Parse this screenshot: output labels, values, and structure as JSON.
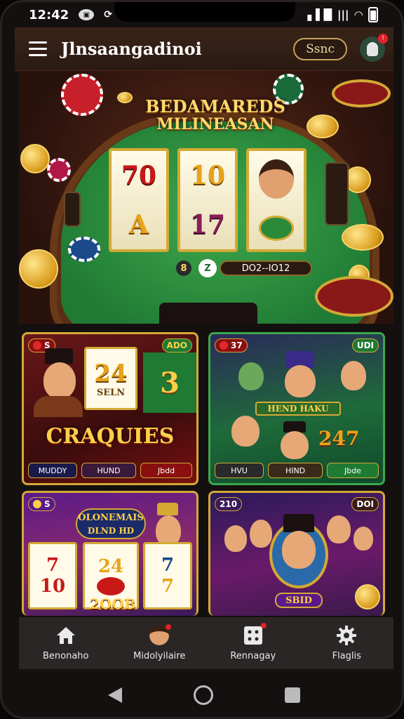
{
  "status_bar": {
    "time": "12:42"
  },
  "header": {
    "title": "Jlnsaangadinoi",
    "send_label": "Ssnc"
  },
  "hero": {
    "title_line1": "BEDAMAREDS",
    "title_line2": "MILINEASAN",
    "reel1": [
      "70",
      "A"
    ],
    "reel2": [
      "10",
      "17"
    ],
    "reel3_label": "",
    "jackpot": "DO2--IO12",
    "ctrl_a": "8",
    "ctrl_b": "Z"
  },
  "games": [
    {
      "badge_l": "S",
      "badge_r": "ADO",
      "reel_a": "24",
      "reel_a_sub": "SELN",
      "reel_b": "3",
      "name": "CRAQUIES",
      "btn1": "MUDDY",
      "btn2": "HUND",
      "btn3": "Jbdd"
    },
    {
      "badge_l": "37",
      "badge_r": "UDI",
      "banner": "HEND HAKU",
      "value": "247",
      "btn1": "HVU",
      "btn2": "HIND",
      "btn3": "Jbde"
    },
    {
      "badge_l": "S",
      "title_l1": "OLONEMAIS",
      "title_l2": "DLND HD",
      "reels": [
        "7",
        "24",
        "7"
      ],
      "reels2": [
        "10",
        "",
        "7"
      ],
      "value": "2OOB"
    },
    {
      "badge_l": "210",
      "badge_r": "DOI",
      "label": "SBID"
    }
  ],
  "nav": [
    {
      "label": "Benonaho",
      "icon": "home-icon"
    },
    {
      "label": "Midolyilaire",
      "icon": "profile-avatar-icon"
    },
    {
      "label": "Rennagay",
      "icon": "dice-icon"
    },
    {
      "label": "Flaglis",
      "icon": "gear-icon"
    }
  ]
}
